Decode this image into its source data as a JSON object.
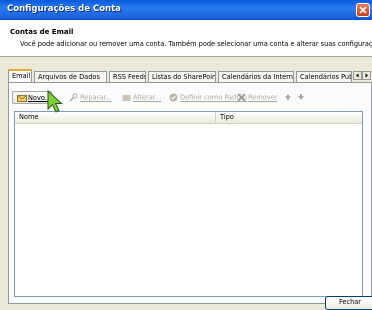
{
  "window": {
    "title": "Configurações de Conta"
  },
  "header": {
    "title": "Contas de Email",
    "description": "Você pode adicionar ou remover uma conta. Também pode selecionar uma conta e alterar suas configurações."
  },
  "tabs": [
    {
      "label": "Email",
      "active": true
    },
    {
      "label": "Arquivos de Dados"
    },
    {
      "label": "RSS Feeds"
    },
    {
      "label": "Listas do SharePoint"
    },
    {
      "label": "Calendários da Internet"
    },
    {
      "label": "Calendários Publica"
    }
  ],
  "toolbar": {
    "new": "Novo...",
    "repair": "Reparar...",
    "change": "Alterar...",
    "set_default": "Definir como Padrão",
    "remove": "Remover"
  },
  "list": {
    "columns": [
      "Nome",
      "Tipo"
    ]
  },
  "footer": {
    "close": "Fechar"
  },
  "colors": {
    "titlebar": "#0a5bdc",
    "active_tab_accent": "#e6a93a"
  }
}
